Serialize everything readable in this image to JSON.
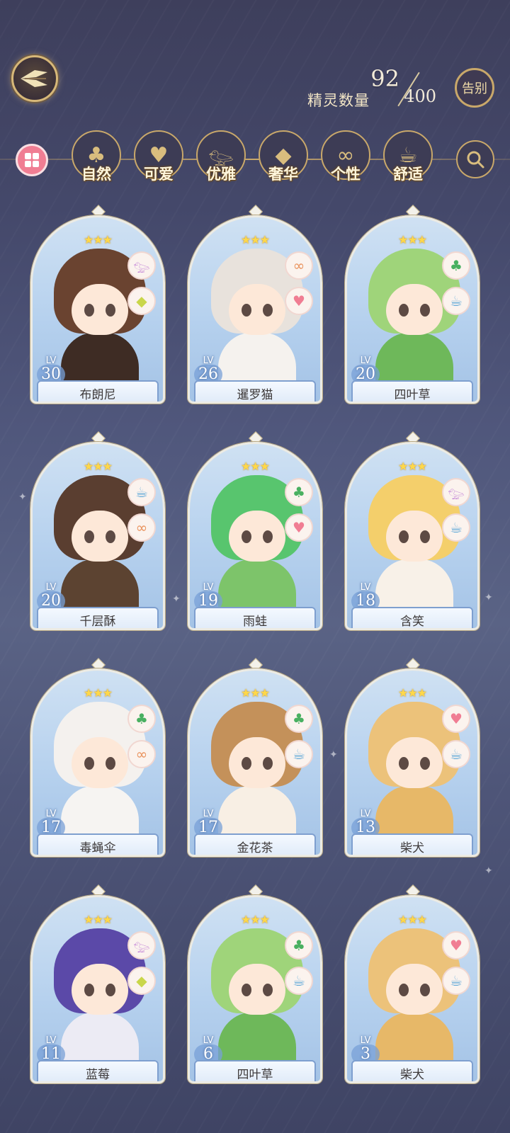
{
  "header": {
    "count_label": "精灵数量",
    "count_current": "92",
    "count_max": "400",
    "farewell_label": "告别"
  },
  "filters": [
    {
      "label": "自然",
      "icon": "clover-icon"
    },
    {
      "label": "可爱",
      "icon": "heart-icon"
    },
    {
      "label": "优雅",
      "icon": "swan-icon"
    },
    {
      "label": "奢华",
      "icon": "diamond-icon"
    },
    {
      "label": "个性",
      "icon": "glasses-icon"
    },
    {
      "label": "舒适",
      "icon": "teacup-icon"
    }
  ],
  "cards": [
    {
      "name": "布朗尼",
      "level": "30",
      "level_tag": "LV",
      "stars": "★★★",
      "traits": [
        "swan-icon",
        "diamond-icon"
      ],
      "hair": "#6a4330",
      "body": "#3e2c24"
    },
    {
      "name": "暹罗猫",
      "level": "26",
      "level_tag": "LV",
      "stars": "★★★",
      "traits": [
        "glasses-icon",
        "heart-icon"
      ],
      "hair": "#e8e2dc",
      "body": "#f5f2ee"
    },
    {
      "name": "四叶草",
      "level": "20",
      "level_tag": "LV",
      "stars": "★★★",
      "traits": [
        "clover-icon",
        "teacup-icon"
      ],
      "hair": "#9fd47a",
      "body": "#6eb85a"
    },
    {
      "name": "千层酥",
      "level": "20",
      "level_tag": "LV",
      "stars": "★★★",
      "traits": [
        "teacup-icon",
        "glasses-icon"
      ],
      "hair": "#5a3e30",
      "body": "#5c4331"
    },
    {
      "name": "雨蛙",
      "level": "19",
      "level_tag": "LV",
      "stars": "★★★",
      "traits": [
        "clover-icon",
        "heart-icon"
      ],
      "hair": "#58c56e",
      "body": "#7dc46a"
    },
    {
      "name": "含笑",
      "level": "18",
      "level_tag": "LV",
      "stars": "★★★",
      "traits": [
        "swan-icon",
        "teacup-icon"
      ],
      "hair": "#f4cf6b",
      "body": "#f8f1e8"
    },
    {
      "name": "毒蝇伞",
      "level": "17",
      "level_tag": "LV",
      "stars": "★★★",
      "traits": [
        "clover-icon",
        "glasses-icon"
      ],
      "hair": "#f4f1ee",
      "body": "#f6f4f2"
    },
    {
      "name": "金花茶",
      "level": "17",
      "level_tag": "LV",
      "stars": "★★★",
      "traits": [
        "clover-icon",
        "teacup-icon"
      ],
      "hair": "#c4915a",
      "body": "#f8efe4"
    },
    {
      "name": "柴犬",
      "level": "13",
      "level_tag": "LV",
      "stars": "★★★",
      "traits": [
        "heart-icon",
        "teacup-icon"
      ],
      "hair": "#ecc27a",
      "body": "#e7b868"
    },
    {
      "name": "蓝莓",
      "level": "11",
      "level_tag": "LV",
      "stars": "★★★",
      "traits": [
        "swan-icon",
        "diamond-icon"
      ],
      "hair": "#5b49a8",
      "body": "#ecebf4"
    },
    {
      "name": "四叶草",
      "level": "6",
      "level_tag": "LV",
      "stars": "★★★",
      "traits": [
        "clover-icon",
        "teacup-icon"
      ],
      "hair": "#9fd47a",
      "body": "#6eb85a"
    },
    {
      "name": "柴犬",
      "level": "3",
      "level_tag": "LV",
      "stars": "★★★",
      "traits": [
        "heart-icon",
        "teacup-icon"
      ],
      "hair": "#ecc27a",
      "body": "#e7b868"
    }
  ],
  "colors": {
    "gold": "#c9a86a",
    "card_blue": "#b6d1ee",
    "star": "#ffd84a"
  }
}
